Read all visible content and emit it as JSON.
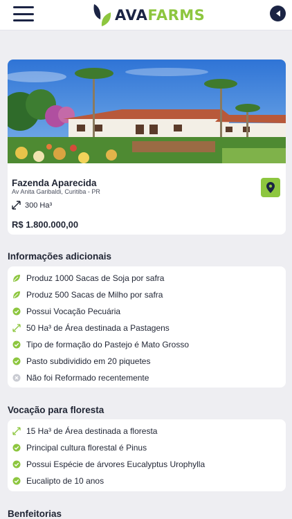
{
  "header": {
    "brand_part1": "AVA",
    "brand_part2": "FARMS"
  },
  "property": {
    "name": "Fazenda Aparecida",
    "address": "Av Anita Garibaldi, Curitiba - PR",
    "area": "300 Ha³",
    "price": "R$ 1.800.000,00"
  },
  "additional_info": {
    "title": "Informações adicionais",
    "items": [
      {
        "icon": "leaf-icon",
        "text": "Produz 1000 Sacas de Soja por safra"
      },
      {
        "icon": "leaf-icon",
        "text": "Produz 500 Sacas de Milho por safra"
      },
      {
        "icon": "check-circle-icon",
        "text": "Possui Vocação Pecuária"
      },
      {
        "icon": "expand-arrows-icon",
        "text": "50 Ha³ de Área destinada a Pastagens"
      },
      {
        "icon": "check-circle-icon",
        "text": "Tipo de formação do Pastejo é Mato Grosso"
      },
      {
        "icon": "check-circle-icon",
        "text": "Pasto subdividido em 20 piquetes"
      },
      {
        "icon": "x-circle-icon",
        "text": "Não foi Reformado recentemente"
      }
    ]
  },
  "forest": {
    "title": "Vocação para floresta",
    "items": [
      {
        "icon": "expand-arrows-icon",
        "text": "15 Ha³ de Área destinada a floresta"
      },
      {
        "icon": "check-circle-icon",
        "text": "Principal cultura florestal é Pinus"
      },
      {
        "icon": "check-circle-icon",
        "text": "Possui Espécie de árvores Eucalyptus Urophylla"
      },
      {
        "icon": "check-circle-icon",
        "text": "Eucalipto de 10 anos"
      }
    ]
  },
  "improvements": {
    "title": "Benfeitorias"
  },
  "colors": {
    "brand_navy": "#1b2444",
    "brand_green": "#8dc63f",
    "background": "#eeeef2",
    "card": "#ffffff"
  }
}
